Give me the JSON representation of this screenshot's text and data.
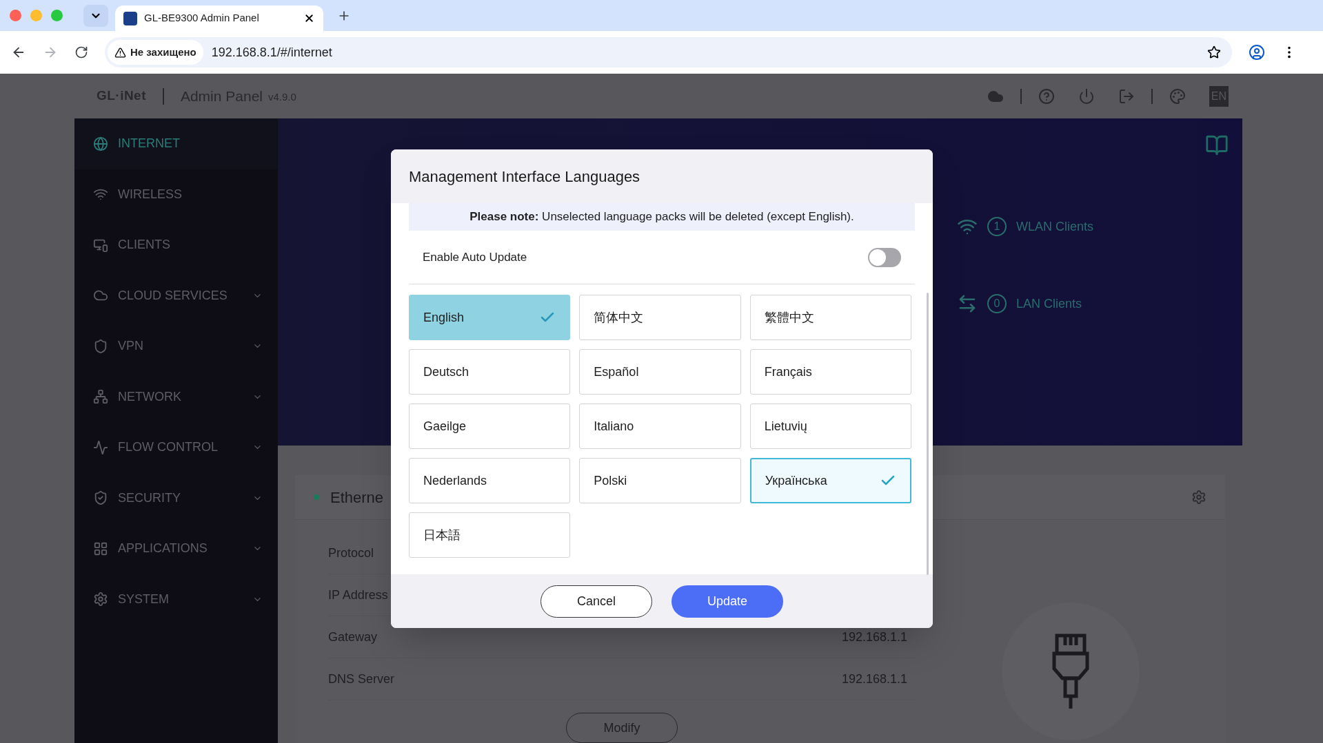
{
  "browser": {
    "tab_title": "GL-BE9300 Admin Panel",
    "security_label": "Не захищено",
    "url": "192.168.8.1/#/internet"
  },
  "header": {
    "logo": "GL·iNet",
    "title": "Admin Panel",
    "version": "v4.9.0",
    "language_badge": "EN"
  },
  "sidebar": {
    "items": [
      {
        "label": "INTERNET",
        "selected": true,
        "expandable": false
      },
      {
        "label": "WIRELESS",
        "selected": false,
        "expandable": false
      },
      {
        "label": "CLIENTS",
        "selected": false,
        "expandable": false
      },
      {
        "label": "CLOUD SERVICES",
        "selected": false,
        "expandable": true
      },
      {
        "label": "VPN",
        "selected": false,
        "expandable": true
      },
      {
        "label": "NETWORK",
        "selected": false,
        "expandable": true
      },
      {
        "label": "FLOW CONTROL",
        "selected": false,
        "expandable": true
      },
      {
        "label": "SECURITY",
        "selected": false,
        "expandable": true
      },
      {
        "label": "APPLICATIONS",
        "selected": false,
        "expandable": true
      },
      {
        "label": "SYSTEM",
        "selected": false,
        "expandable": true
      }
    ]
  },
  "banner": {
    "clients": [
      {
        "kind": "wlan",
        "count": "1",
        "label": "WLAN Clients"
      },
      {
        "kind": "lan",
        "count": "0",
        "label": "LAN Clients"
      }
    ]
  },
  "ethernet": {
    "title": "Etherne",
    "connected": true,
    "rows": [
      {
        "label": "Protocol"
      },
      {
        "label": "IP Address"
      },
      {
        "label": "Gateway",
        "value": "192.168.1.1"
      },
      {
        "label": "DNS Server",
        "value": "192.168.1.1"
      }
    ],
    "button": "Modify"
  },
  "dialog": {
    "title": "Management Interface Languages",
    "note": "**Please note:** Unselected language packs will be deleted (except English).",
    "auto_update": {
      "label": "Enable Auto Update",
      "on": false
    },
    "languages": [
      {
        "label": "English",
        "selected": true,
        "locked": true
      },
      {
        "label": "简体中文",
        "selected": false,
        "locked": false
      },
      {
        "label": "繁體中文",
        "selected": false,
        "locked": false
      },
      {
        "label": "Deutsch",
        "selected": false,
        "locked": false
      },
      {
        "label": "Español",
        "selected": false,
        "locked": false
      },
      {
        "label": "Français",
        "selected": false,
        "locked": false
      },
      {
        "label": "Gaeilge",
        "selected": false,
        "locked": false
      },
      {
        "label": "Italiano",
        "selected": false,
        "locked": false
      },
      {
        "label": "Lietuvių",
        "selected": false,
        "locked": false
      },
      {
        "label": "Nederlands",
        "selected": false,
        "locked": false
      },
      {
        "label": "Polski",
        "selected": false,
        "locked": false
      },
      {
        "label": "Українська",
        "selected": true,
        "locked": false
      },
      {
        "label": "日本語",
        "selected": false,
        "locked": false
      }
    ],
    "buttons": {
      "cancel": "Cancel",
      "update": "Update"
    }
  }
}
